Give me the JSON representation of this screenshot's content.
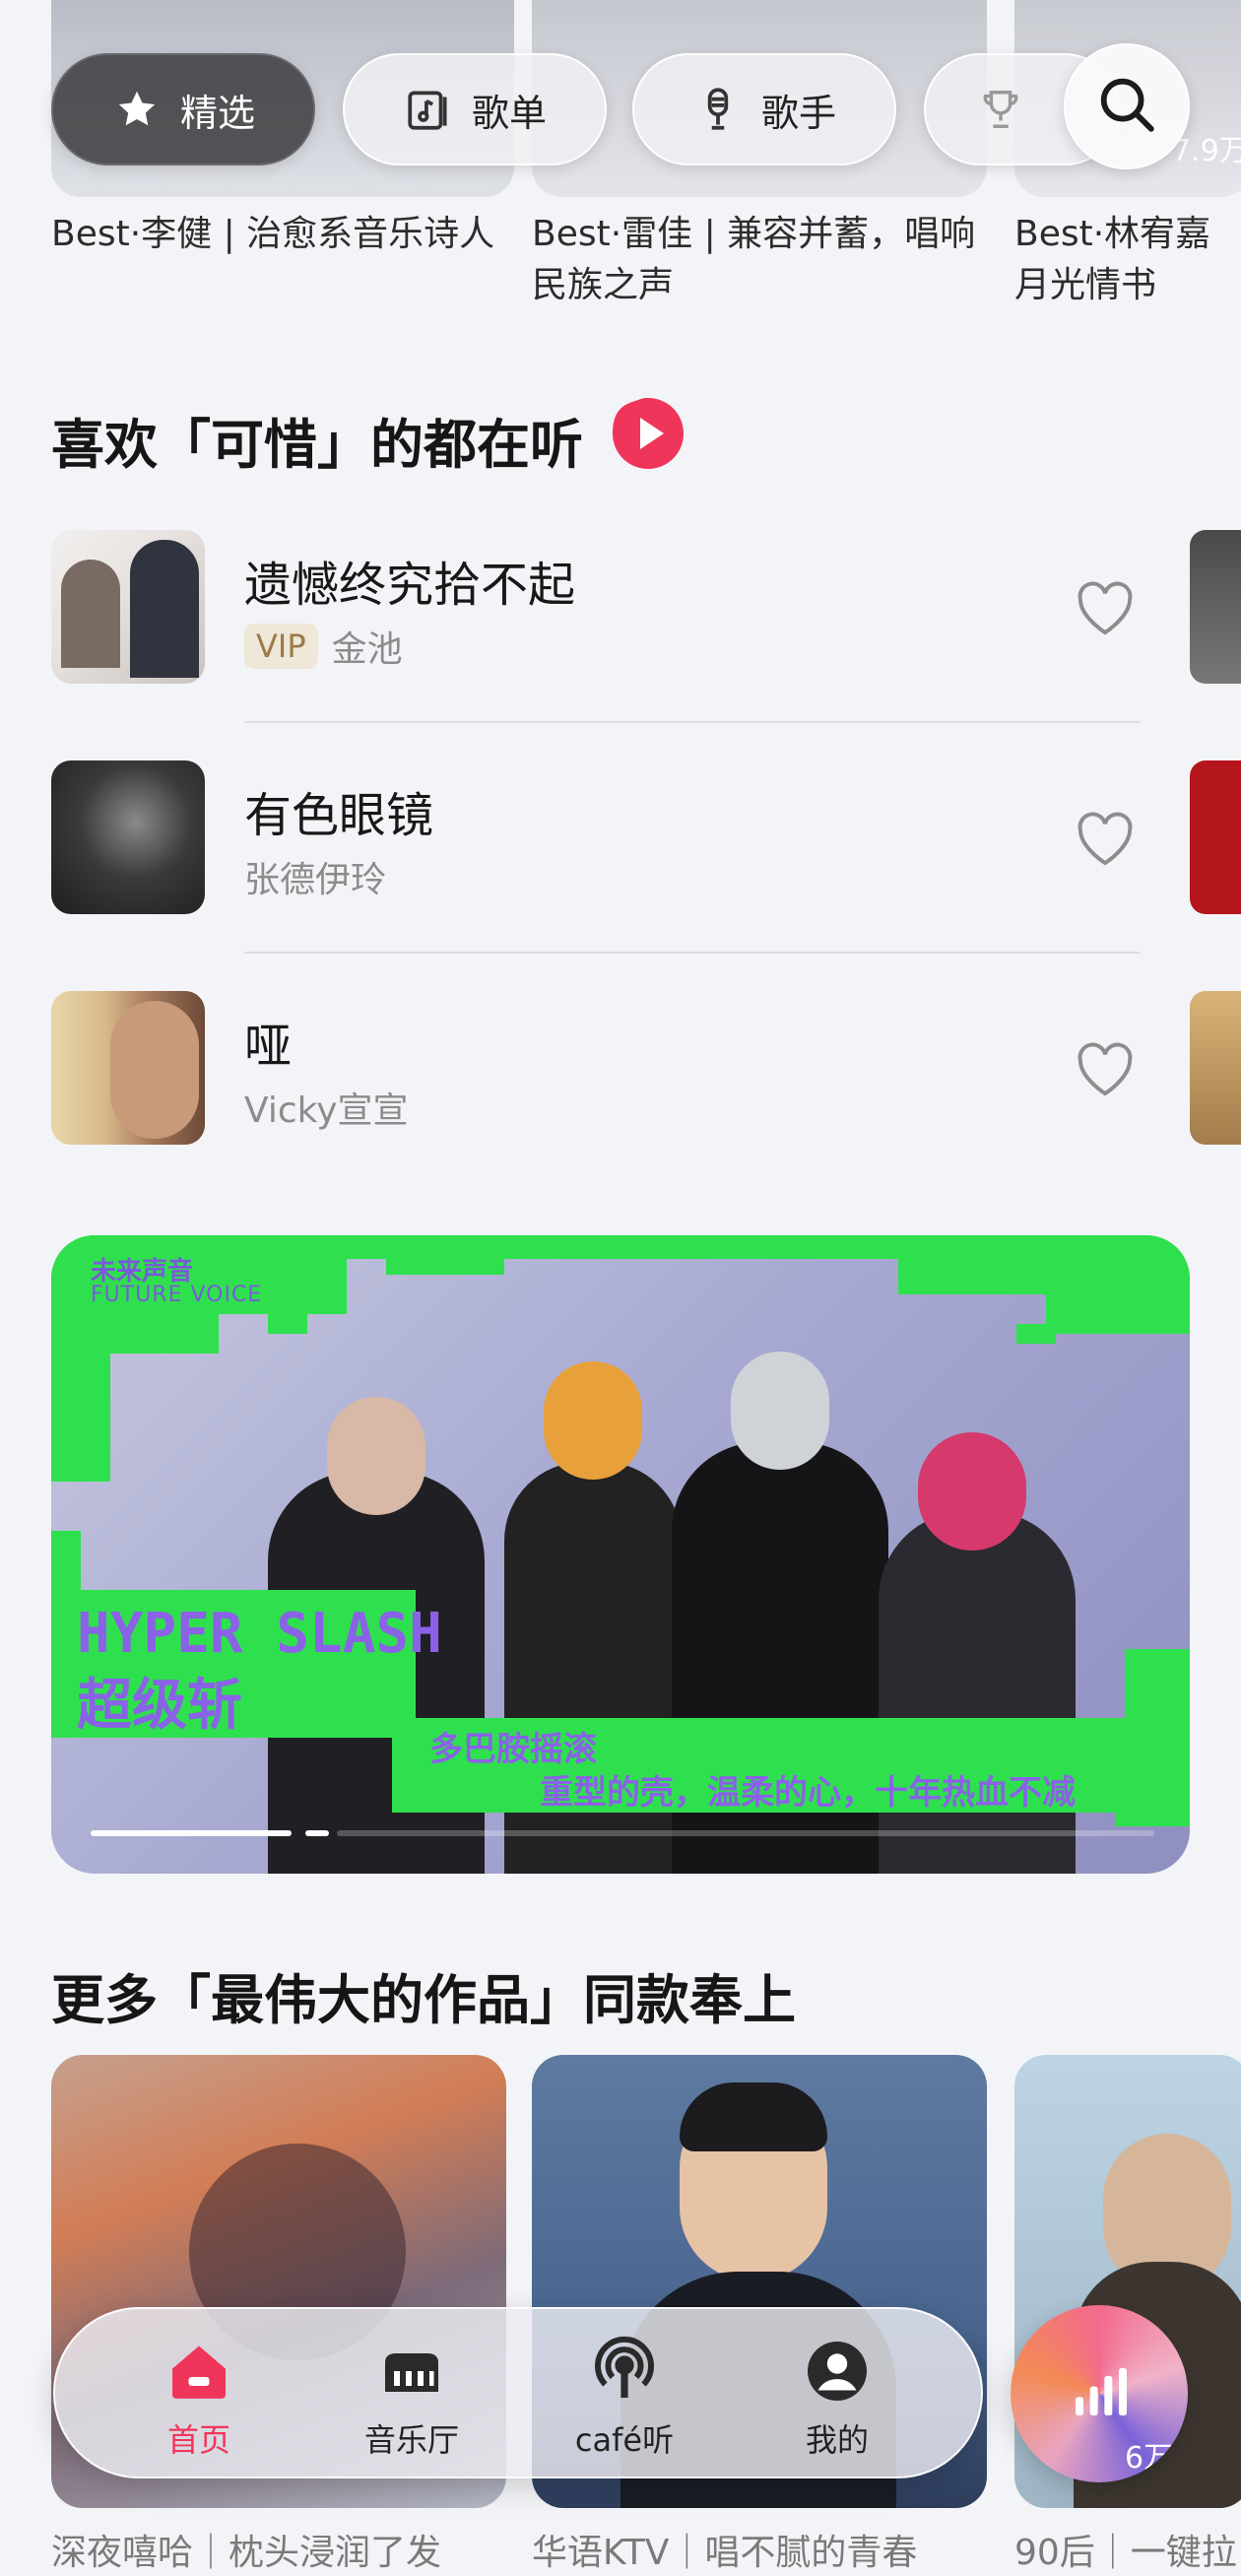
{
  "top_nav": {
    "chips": [
      {
        "label": "精选",
        "icon": "star-icon",
        "active": true
      },
      {
        "label": "歌单",
        "icon": "music-note-icon",
        "active": false
      },
      {
        "label": "歌手",
        "icon": "microphone-icon",
        "active": false
      },
      {
        "label": "",
        "icon": "trophy-icon",
        "active": false
      }
    ],
    "search_icon": "search-icon"
  },
  "top_cards": [
    {
      "caption": "Best·李健 | 治愈系音乐诗人"
    },
    {
      "caption": "Best·雷佳 | 兼容并蓄，唱响民族之声"
    },
    {
      "caption": "Best·林宥嘉月光情书"
    }
  ],
  "top_card_peek_count": "7.9万",
  "section_like": {
    "title": "喜欢「可惜」的都在听",
    "play_icon": "play-icon"
  },
  "songs": [
    {
      "title": "遗憾终究拾不起",
      "artist": "金池",
      "vip": "VIP"
    },
    {
      "title": "有色眼镜",
      "artist": "张德伊玲",
      "vip": ""
    },
    {
      "title": "哑",
      "artist": "Vicky宣宣",
      "vip": ""
    }
  ],
  "banner": {
    "brand_cn": "未来声音",
    "brand_en": "FUTURE VOICE",
    "headline_en": "HYPER SLASH",
    "headline_cn": "超级斩",
    "sub1": "多巴胺摇滚",
    "sub2": "重型的壳，温柔的心，十年热血不减"
  },
  "section_more": {
    "title": "更多「最伟大的作品」同款奉上"
  },
  "bottom_cards": [
    {
      "caption": "深夜嘻哈｜枕头浸润了发"
    },
    {
      "caption": "华语KTV｜唱不腻的青春"
    },
    {
      "caption": "90后｜一键拉"
    }
  ],
  "bottom_card_peek_count": "6万",
  "tabbar": {
    "tabs": [
      {
        "label": "首页",
        "icon": "home-icon",
        "active": true
      },
      {
        "label": "音乐厅",
        "icon": "music-hall-icon",
        "active": false
      },
      {
        "label": "café听",
        "icon": "podcast-icon",
        "active": false
      },
      {
        "label": "我的",
        "icon": "profile-icon",
        "active": false
      }
    ]
  },
  "colors": {
    "accent": "#f0355a",
    "background": "#f3f4f7",
    "neon_green": "#2fe04e",
    "banner_purple": "#8a62e6"
  }
}
